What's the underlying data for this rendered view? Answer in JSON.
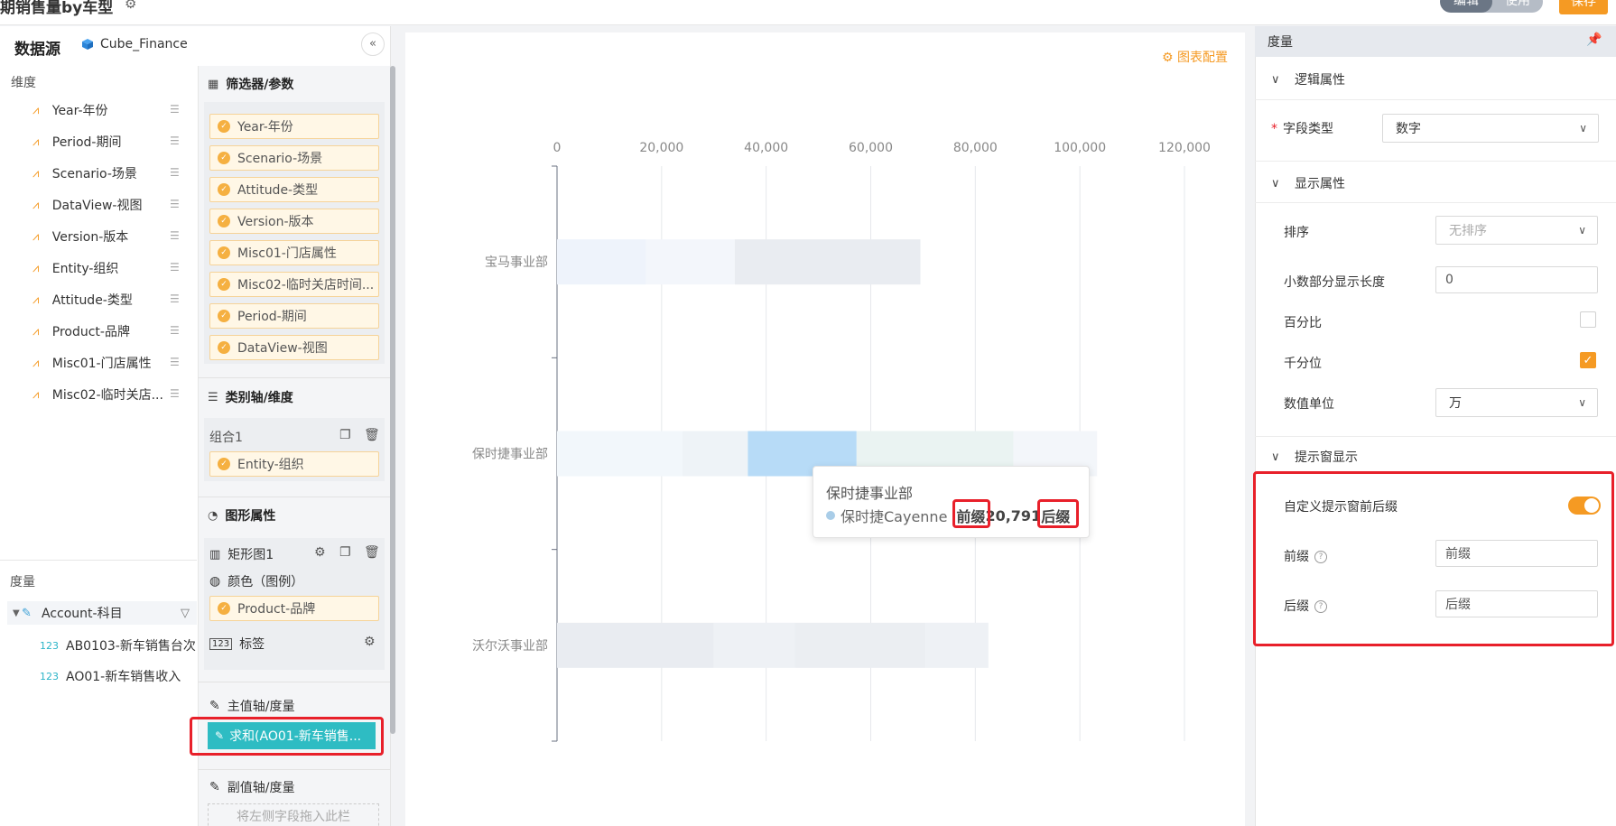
{
  "header": {
    "title": "期销售量by车型",
    "mode_edit": "编辑",
    "mode_use": "使用",
    "save": "保存"
  },
  "datasource": {
    "title": "数据源",
    "cube": "Cube_Finance",
    "collapse_icon": "double-chevron-left-icon",
    "dimensions_label": "维度",
    "dimensions": [
      "Year-年份",
      "Period-期间",
      "Scenario-场景",
      "DataView-视图",
      "Version-版本",
      "Entity-组织",
      "Attitude-类型",
      "Product-品牌",
      "Misc01-门店属性",
      "Misc02-临时关店..."
    ],
    "measures_label": "度量",
    "account": "Account-科目",
    "measures": [
      {
        "icon": "123",
        "label": "AB0103-新车销售台次"
      },
      {
        "icon": "123",
        "label": "AO01-新车销售收入"
      }
    ]
  },
  "config": {
    "filter_title": "筛选器/参数",
    "filters": [
      "Year-年份",
      "Scenario-场景",
      "Attitude-类型",
      "Version-版本",
      "Misc01-门店属性",
      "Misc02-临时关店时间...",
      "Period-期间",
      "DataView-视图"
    ],
    "category_title": "类别轴/维度",
    "group_label": "组合1",
    "category_pill": "Entity-组织",
    "shape_title": "图形属性",
    "shape_name": "矩形图1",
    "color_label": "颜色（图例）",
    "color_pill": "Product-品牌",
    "tag_label": "标签",
    "main_axis_title": "主值轴/度量",
    "main_axis_pill": "求和(AO01-新车销售...",
    "sub_axis_title": "副值轴/度量",
    "drop_hint": "将左侧字段拖入此栏"
  },
  "chart": {
    "config_link": "图表配置",
    "tooltip": {
      "title": "保时捷事业部",
      "series": "保时捷Cayenne",
      "prefix": "前缀",
      "value": "20,791",
      "suffix": "后缀"
    }
  },
  "chart_data": {
    "type": "bar",
    "orientation": "horizontal",
    "stacked": true,
    "categories": [
      "宝马事业部",
      "保时捷事业部",
      "沃尔沃事业部"
    ],
    "x_ticks": [
      "0",
      "20,000",
      "40,000",
      "60,000",
      "80,000",
      "100,000",
      "120,000"
    ],
    "xlim": [
      0,
      120000
    ],
    "stacks": [
      [
        {
          "value": 17000,
          "color": "#eef3fb"
        },
        {
          "value": 17000,
          "color": "#f3f6fb"
        },
        {
          "value": 35500,
          "color": "#e9ecf1"
        }
      ],
      [
        {
          "value": 24000,
          "color": "#f2f7fb"
        },
        {
          "value": 12500,
          "color": "#eef3f7"
        },
        {
          "value": 20791,
          "color": "#b7dbf7"
        },
        {
          "value": 30000,
          "color": "#eaf3f2"
        },
        {
          "value": 16000,
          "color": "#f3f6fa"
        }
      ],
      [
        {
          "value": 30000,
          "color": "#e9ecf1"
        },
        {
          "value": 15500,
          "color": "#eef1f5"
        },
        {
          "value": 25000,
          "color": "#ebeef2"
        },
        {
          "value": 12000,
          "color": "#eef1f5"
        }
      ]
    ]
  },
  "measure_panel": {
    "title": "度量",
    "pin_icon": "pin-icon",
    "logic_section": "逻辑属性",
    "field_type_label": "字段类型",
    "field_type_value": "数字",
    "display_section": "显示属性",
    "sort_label": "排序",
    "sort_placeholder": "无排序",
    "decimal_label": "小数部分显示长度",
    "decimal_value": "0",
    "percent_label": "百分比",
    "percent_checked": false,
    "thousands_label": "千分位",
    "thousands_checked": true,
    "unit_label": "数值单位",
    "unit_value": "万",
    "tooltip_section": "提示窗显示",
    "custom_fix_label": "自定义提示窗前后缀",
    "custom_fix_on": true,
    "prefix_label": "前缀",
    "prefix_value": "前缀",
    "suffix_label": "后缀",
    "suffix_value": "后缀"
  }
}
